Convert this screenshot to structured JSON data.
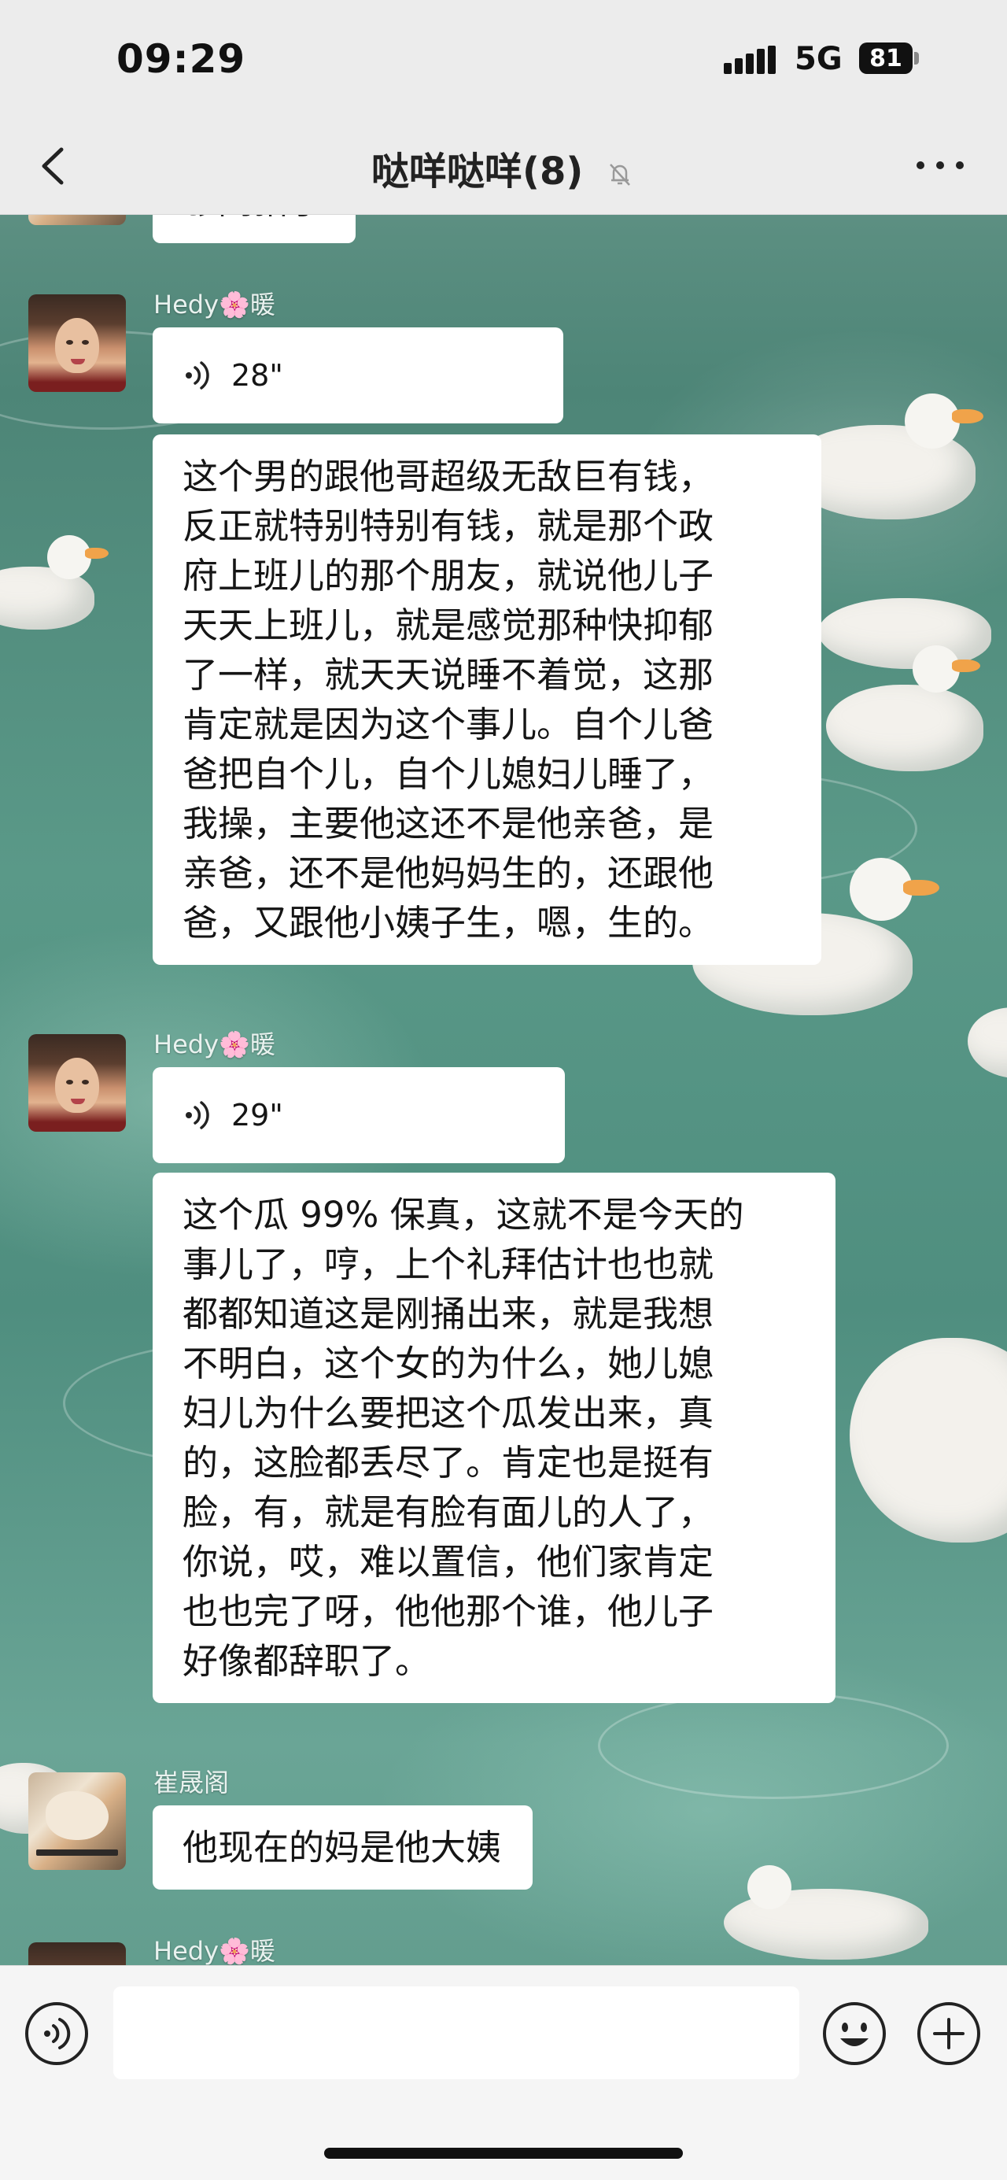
{
  "status_bar": {
    "time": "09:29",
    "network": "5G",
    "battery": "81"
  },
  "header": {
    "title": "哒咩哒咩(8)",
    "back_icon": "chevron-left-icon",
    "mute_icon": "bell-off-icon",
    "more_icon": "more-horizontal-icon"
  },
  "messages": [
    {
      "type": "text",
      "text": "够闹猎了"
    },
    {
      "sender": "Hedy",
      "sender_flower": "🌸",
      "sender_suffix": "暖",
      "type": "voice",
      "duration": "28\""
    },
    {
      "type": "text",
      "text": "这个男的跟他哥超级无敌巨有钱，\n反正就特别特别有钱，就是那个政\n府上班儿的那个朋友，就说他儿子\n天天上班儿，就是感觉那种快抑郁\n了一样，就天天说睡不着觉，这那\n肯定就是因为这个事儿。自个儿爸\n爸把自个儿，自个儿媳妇儿睡了，\n我操，主要他这还不是他亲爸，是\n亲爸，还不是他妈妈生的，还跟他\n爸，又跟他小姨子生，嗯，生的。"
    },
    {
      "sender": "Hedy",
      "sender_flower": "🌸",
      "sender_suffix": "暖",
      "type": "voice",
      "duration": "29\""
    },
    {
      "type": "text",
      "text": "这个瓜 99% 保真，这就不是今天的\n事儿了，哼，上个礼拜估计也也就\n都都知道这是刚捅出来，就是我想\n不明白，这个女的为什么，她儿媳\n妇儿为什么要把这个瓜发出来，真\n的，这脸都丢尽了。肯定也是挺有\n脸，有，就是有脸有面儿的人了，\n你说，哎，难以置信，他们家肯定\n也也完了呀，他他那个谁，他儿子\n好像都辞职了。"
    },
    {
      "sender": "崔晟阁",
      "type": "text",
      "text": "他现在的妈是他大姨"
    },
    {
      "sender": "Hedy",
      "sender_flower": "🌸",
      "sender_suffix": "暖"
    }
  ],
  "input_bar": {
    "voice_icon": "voice-wave-icon",
    "emoji_icon": "smile-icon",
    "plus_icon": "plus-circle-icon",
    "input_value": ""
  }
}
